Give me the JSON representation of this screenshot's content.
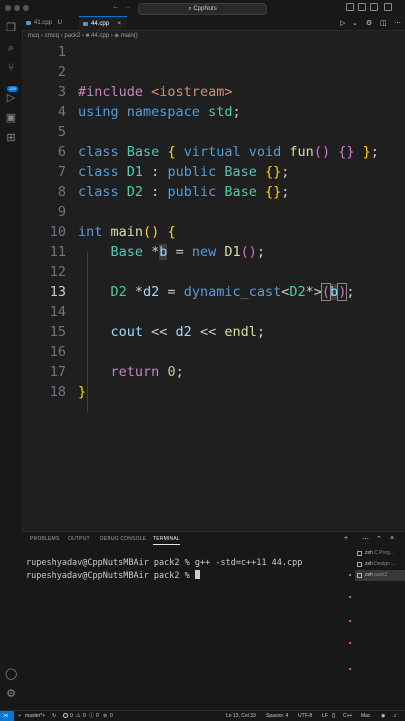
{
  "window": {
    "title": "CppNuts"
  },
  "tabs": [
    {
      "label": "41.cpp",
      "status": "U"
    },
    {
      "label": "44.cpp",
      "status": "U"
    }
  ],
  "breadcrumb": [
    "mcq",
    "cmcq",
    "pack2",
    "44.cpp",
    "main()"
  ],
  "activity_icons": [
    "explorer-icon",
    "search-icon",
    "source-control-icon",
    "run-debug-icon",
    "remote-explorer-icon",
    "extensions-icon",
    "account-icon",
    "settings-icon"
  ],
  "source_control_badge": "129",
  "editor": {
    "lines": [
      {
        "n": "1",
        "code": ""
      },
      {
        "n": "2",
        "code": ""
      },
      {
        "n": "3",
        "code": "#include <iostream>"
      },
      {
        "n": "4",
        "code": "using namespace std;"
      },
      {
        "n": "5",
        "code": ""
      },
      {
        "n": "6",
        "code": "class Base { virtual void fun() {} };"
      },
      {
        "n": "7",
        "code": "class D1 : public Base {};"
      },
      {
        "n": "8",
        "code": "class D2 : public Base {};"
      },
      {
        "n": "9",
        "code": ""
      },
      {
        "n": "10",
        "code": "int main() {"
      },
      {
        "n": "11",
        "code": "    Base *b = new D1();"
      },
      {
        "n": "12",
        "code": ""
      },
      {
        "n": "13",
        "code": "    D2 *d2 = dynamic_cast<D2*>(b);"
      },
      {
        "n": "14",
        "code": ""
      },
      {
        "n": "15",
        "code": "    cout << d2 << endl;"
      },
      {
        "n": "16",
        "code": ""
      },
      {
        "n": "17",
        "code": "    return 0;"
      },
      {
        "n": "18",
        "code": "}"
      }
    ],
    "current_line": 13
  },
  "panel": {
    "tabs": [
      "PROBLEMS",
      "OUTPUT",
      "DEBUG CONSOLE",
      "TERMINAL"
    ],
    "active_tab": "TERMINAL",
    "terminal_lines": [
      "rupeshyadav@CppNutsMBAir pack2 % g++ -std=c++11 44.cpp",
      "rupeshyadav@CppNutsMBAir pack2 % "
    ],
    "terminal_list": [
      {
        "name": "zsh",
        "desc": "C Prog..."
      },
      {
        "name": "zsh",
        "desc": "Design ..."
      },
      {
        "name": "zsh",
        "desc": "pack2"
      }
    ]
  },
  "statusbar": {
    "branch": "master*+",
    "errors": "0",
    "warnings": "0",
    "info": "0",
    "ports": "0",
    "position": "Ln 13, Col 33",
    "spaces": "Spaces: 4",
    "encoding": "UTF-8",
    "eol": "LF",
    "language": "C++",
    "platform": "Mac"
  },
  "colors": {
    "accent": "#0078d4",
    "keyword": "#569cd6",
    "type": "#4ec9b0",
    "function": "#dcdcaa",
    "preprocessor": "#c586c0",
    "string": "#ce9178",
    "number": "#b5cea8",
    "variable": "#9cdcfe",
    "bracket": "#ffd700"
  }
}
